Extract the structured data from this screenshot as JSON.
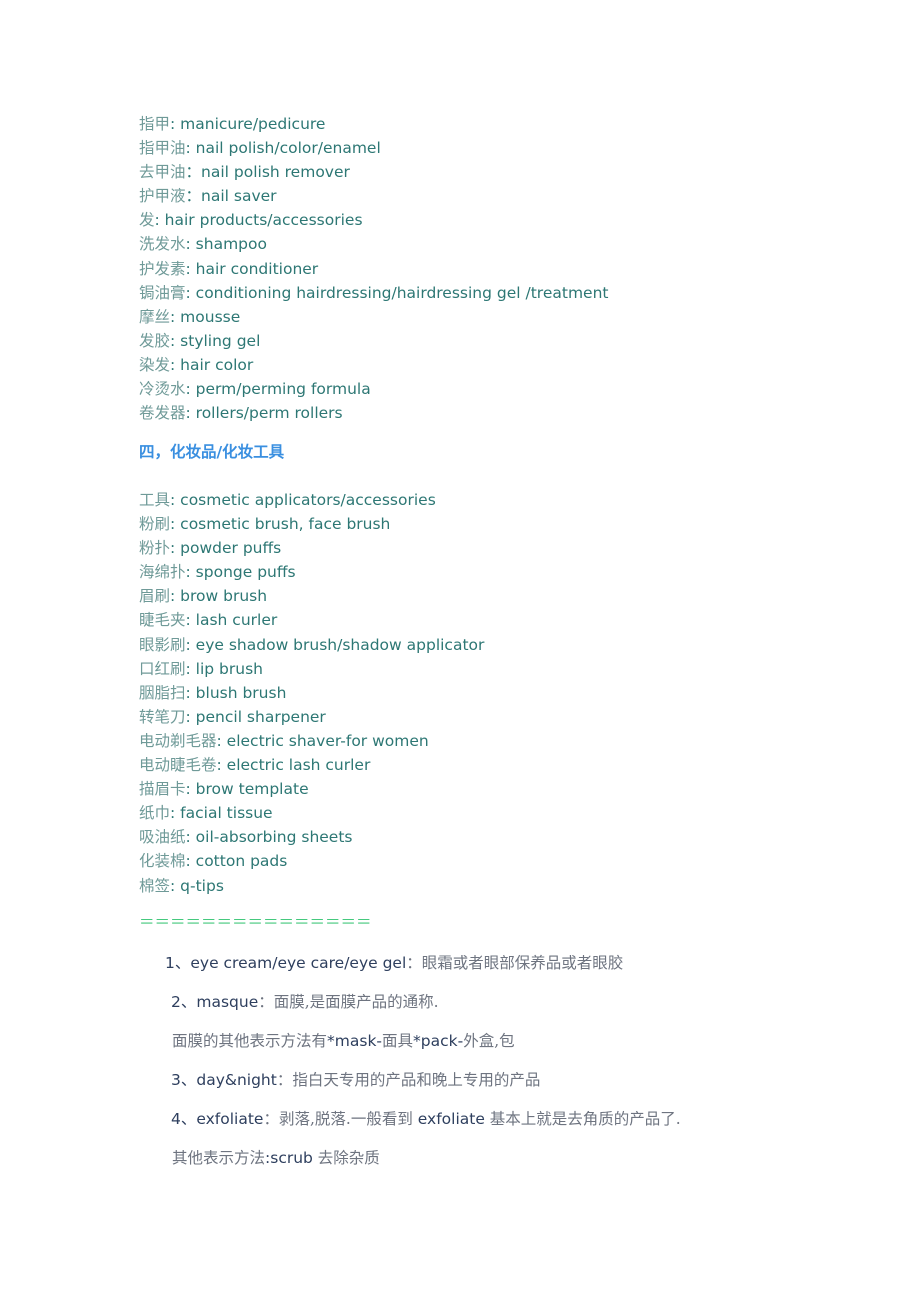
{
  "vocab_section_1": [
    {
      "zh": "指甲",
      "sep": ": ",
      "en": "manicure/pedicure"
    },
    {
      "zh": "指甲油",
      "sep": ": ",
      "en": "nail polish/color/enamel"
    },
    {
      "zh": "去甲油",
      "sep": "：",
      "en": "nail polish remover"
    },
    {
      "zh": "护甲液",
      "sep": "：",
      "en": "nail saver"
    },
    {
      "zh": "发",
      "sep": ": ",
      "en": "hair products/accessories"
    },
    {
      "zh": "洗发水",
      "sep": ": ",
      "en": "shampoo"
    },
    {
      "zh": "护发素",
      "sep": ": ",
      "en": "hair conditioner"
    },
    {
      "zh": "锔油膏",
      "sep": ": ",
      "en": "conditioning hairdressing/hairdressing gel /treatment"
    },
    {
      "zh": "摩丝",
      "sep": ": ",
      "en": "mousse"
    },
    {
      "zh": "发胶",
      "sep": ": ",
      "en": "styling gel"
    },
    {
      "zh": "染发",
      "sep": ": ",
      "en": "hair color"
    },
    {
      "zh": "冷烫水",
      "sep": ": ",
      "en": "perm/perming formula"
    },
    {
      "zh": "卷发器",
      "sep": ": ",
      "en": "rollers/perm rollers"
    }
  ],
  "section_heading": "四，化妆品/化妆工具",
  "vocab_section_2": [
    {
      "zh": "工具",
      "sep": ": ",
      "en": "cosmetic applicators/accessories"
    },
    {
      "zh": "粉刷",
      "sep": ": ",
      "en": "cosmetic brush, face brush"
    },
    {
      "zh": "粉扑",
      "sep": ": ",
      "en": "powder puffs"
    },
    {
      "zh": "海绵扑",
      "sep": ": ",
      "en": "sponge puffs"
    },
    {
      "zh": "眉刷",
      "sep": ": ",
      "en": "brow brush"
    },
    {
      "zh": "睫毛夹",
      "sep": ": ",
      "en": "lash curler"
    },
    {
      "zh": "眼影刷",
      "sep": ": ",
      "en": "eye shadow brush/shadow applicator"
    },
    {
      "zh": "口红刷",
      "sep": ": ",
      "en": "lip brush"
    },
    {
      "zh": "胭脂扫",
      "sep": ": ",
      "en": "blush brush"
    },
    {
      "zh": "转笔刀",
      "sep": ": ",
      "en": "pencil sharpener"
    },
    {
      "zh": "电动剃毛器",
      "sep": ": ",
      "en": "electric shaver-for women"
    },
    {
      "zh": "电动睫毛卷",
      "sep": ": ",
      "en": "electric lash curler"
    },
    {
      "zh": "描眉卡",
      "sep": ": ",
      "en": "brow template"
    },
    {
      "zh": "纸巾",
      "sep": ": ",
      "en": "facial tissue"
    },
    {
      "zh": "吸油纸",
      "sep": ": ",
      "en": "oil-absorbing sheets"
    },
    {
      "zh": "化装棉",
      "sep": ": ",
      "en": "cotton pads"
    },
    {
      "zh": "棉签",
      "sep": ": ",
      "en": "q-tips"
    }
  ],
  "divider": "＝＝＝＝＝＝＝＝＝＝＝＝＝＝＝",
  "notes": [
    {
      "parts": [
        {
          "t": "1、eye cream/eye care/eye gel",
          "c": "en"
        },
        {
          "t": "：眼霜或者眼部保养品或者眼胶",
          "c": "zh"
        }
      ]
    },
    {
      "parts": [
        {
          "t": "2、masque",
          "c": "en"
        },
        {
          "t": "：面膜,是面膜产品的通称.",
          "c": "zh"
        }
      ]
    },
    {
      "parts": [
        {
          "t": "面膜的其他表示方法有",
          "c": "zh"
        },
        {
          "t": "*mask-",
          "c": "en"
        },
        {
          "t": "面具",
          "c": "zh"
        },
        {
          "t": "*pack-",
          "c": "en"
        },
        {
          "t": "外盒,包",
          "c": "zh"
        }
      ]
    },
    {
      "parts": [
        {
          "t": "3、day&night",
          "c": "en"
        },
        {
          "t": "：指白天专用的产品和晚上专用的产品",
          "c": "zh"
        }
      ]
    },
    {
      "parts": [
        {
          "t": "4、exfoliate",
          "c": "en"
        },
        {
          "t": "：剥落,脱落.一般看到 ",
          "c": "zh"
        },
        {
          "t": "exfoliate",
          "c": "en"
        },
        {
          "t": " 基本上就是去角质的产品了.",
          "c": "zh"
        }
      ]
    },
    {
      "parts": [
        {
          "t": "其他表示方法",
          "c": "zh"
        },
        {
          "t": ":scrub",
          "c": "en"
        },
        {
          "t": " 去除杂质",
          "c": "zh"
        }
      ]
    }
  ],
  "colors": {
    "vocab_en": "#2d7774",
    "vocab_zh": "#6f9a98",
    "heading": "#3a8fe0",
    "divider": "#45c97e",
    "notes_en": "#2e3f5e",
    "notes_zh": "#6e7480"
  }
}
